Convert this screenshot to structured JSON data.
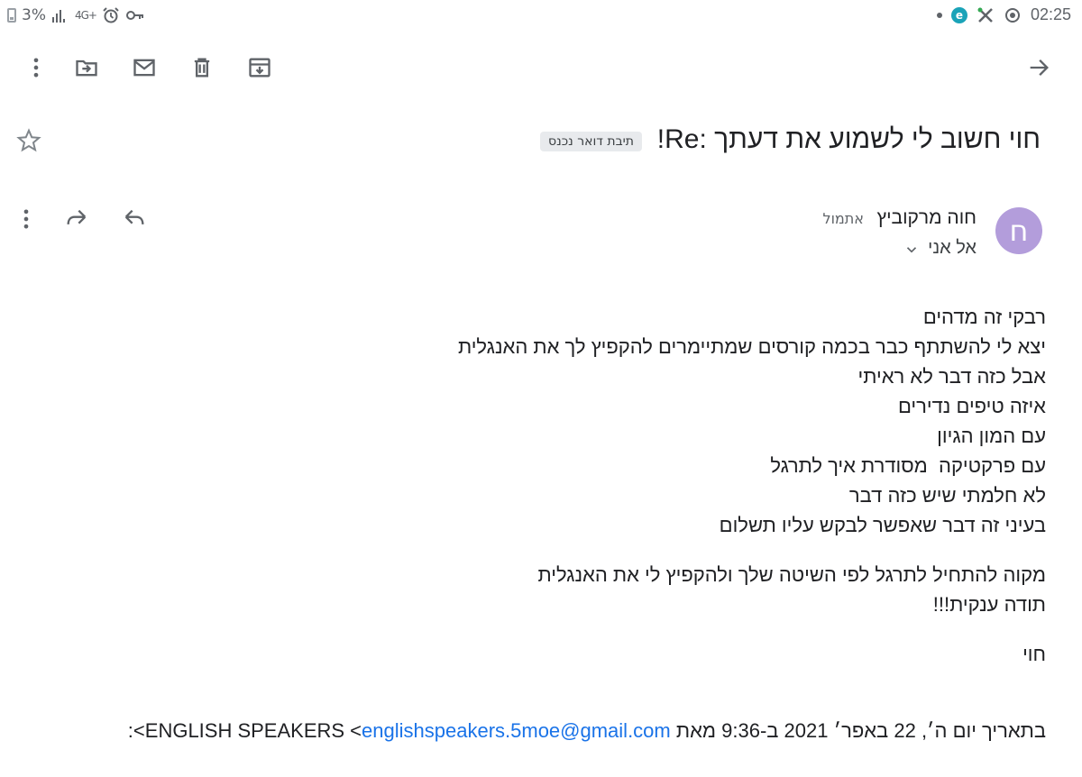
{
  "status_bar": {
    "battery_percent": "3%",
    "network_type": "4G+",
    "time": "02:25"
  },
  "toolbar": {
    "icons": [
      "more-vert-icon",
      "move-to-folder-icon",
      "mark-unread-icon",
      "delete-icon",
      "archive-icon",
      "back-arrow-icon"
    ]
  },
  "email": {
    "subject": "חוי חשוב לי לשמוע את דעתך :Re!",
    "label": "תיבת דואר נכנס",
    "sender": {
      "avatar_letter": "ח",
      "avatar_color": "#b39ddb",
      "name": "חוה מרקוביץ",
      "time": "אתמול",
      "recipient": "אל אני"
    },
    "body_lines": [
      "רבקי זה מדהים",
      "יצא לי להשתתף כבר בכמה קורסים שמתיימרים להקפיץ לך את האנגלית",
      "אבל כזה דבר לא ראיתי",
      "איזה טיפים נדירים",
      "עם המון הגיון",
      "עם פרקטיקה  מסודרת איך לתרגל",
      "לא חלמתי שיש כזה דבר",
      "בעיני זה דבר שאפשר לבקש עליו תשלום",
      "",
      "מקוה להתחיל לתרגל לפי השיטה שלך ולהקפיץ לי את האנגלית",
      "תודה ענקית!!!",
      "",
      "חוי"
    ],
    "quote_prefix": "בתאריך יום ה׳, 22 באפר׳ 2021 ב-9:36 מאת ENGLISH SPEAKERS <",
    "quote_email": "englishspeakers.5moe@gmail.com",
    "quote_suffix": ">:"
  },
  "colors": {
    "link": "#1a73e8",
    "label_chip_bg": "#e8eaed"
  }
}
